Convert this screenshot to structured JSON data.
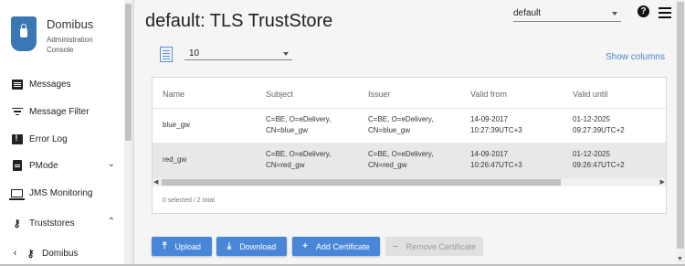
{
  "brand": {
    "title": "Domibus",
    "subtitle": "Administration Console"
  },
  "sidebar": {
    "items": [
      {
        "label": "Messages",
        "icon": "message-icon"
      },
      {
        "label": "Message Filter",
        "icon": "filter-icon"
      },
      {
        "label": "Error Log",
        "icon": "error-icon"
      },
      {
        "label": "PMode",
        "icon": "document-icon",
        "expand": "chevron-down"
      },
      {
        "label": "JMS Monitoring",
        "icon": "laptop-icon"
      },
      {
        "label": "Truststores",
        "icon": "key-icon",
        "expand": "chevron-up"
      },
      {
        "label": "Domibus",
        "icon": "key-icon"
      }
    ]
  },
  "header": {
    "title": "default: TLS TrustStore",
    "domain_select": "default"
  },
  "toolbar": {
    "page_size": "10",
    "show_columns": "Show columns"
  },
  "table": {
    "columns": [
      "Name",
      "Subject",
      "Issuer",
      "Valid from",
      "Valid until"
    ],
    "rows": [
      {
        "name": "blue_gw",
        "subject_1": "C=BE, O=eDelivery,",
        "subject_2": "CN=blue_gw",
        "issuer_1": "C=BE, O=eDelivery,",
        "issuer_2": "CN=blue_gw",
        "from_1": "14-09-2017",
        "from_2": "10:27:39UTC+3",
        "until_1": "01-12-2025",
        "until_2": "09:27:39UTC+2"
      },
      {
        "name": "red_gw",
        "subject_1": "C=BE, O=eDelivery,",
        "subject_2": "CN=red_gw",
        "issuer_1": "C=BE, O=eDelivery,",
        "issuer_2": "CN=red_gw",
        "from_1": "14-09-2017",
        "from_2": "10:26:47UTC+3",
        "until_1": "01-12-2025",
        "until_2": "09:26:47UTC+2"
      }
    ],
    "footer": "0 selected / 2 total"
  },
  "actions": {
    "upload": "Upload",
    "download": "Download",
    "add": "Add Certificate",
    "remove": "Remove Certificate"
  },
  "colors": {
    "accent": "#4a86d8",
    "link": "#4a89c8",
    "logo": "#3a78b5"
  }
}
